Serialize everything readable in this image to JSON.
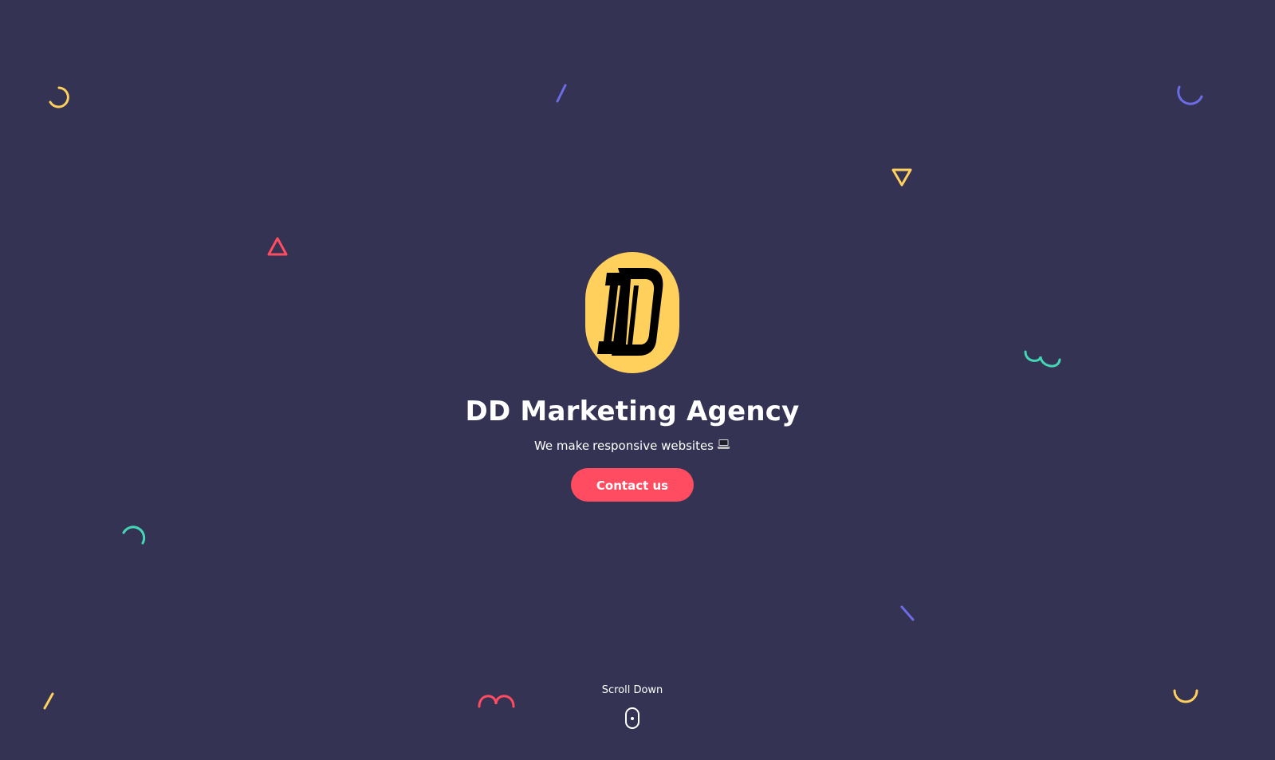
{
  "theme": {
    "background": "#353353",
    "accent_red": "#FF4C60",
    "accent_yellow": "#FFD15C",
    "accent_purple": "#6C6CE5",
    "accent_teal": "#44D7B6"
  },
  "hero": {
    "logo_icon": "dd-monogram-logo",
    "title": "DD Marketing Agency",
    "tagline_prefix": "We make",
    "tagline_rotating": "responsive websites",
    "tagline_icon": "laptop-icon",
    "cta_label": "Contact us"
  },
  "scroll_hint": {
    "label": "Scroll Down",
    "icon": "mouse-icon"
  },
  "decorations": [
    {
      "name": "arc-shape",
      "color": "#FFD15C"
    },
    {
      "name": "line-shape",
      "color": "#6C6CE5"
    },
    {
      "name": "arc-shape",
      "color": "#6C6CE5"
    },
    {
      "name": "triangle-shape",
      "color": "#FFD15C"
    },
    {
      "name": "triangle-shape",
      "color": "#FF4C60"
    },
    {
      "name": "squiggle-shape",
      "color": "#44D7B6"
    },
    {
      "name": "arc-shape",
      "color": "#44D7B6"
    },
    {
      "name": "line-shape",
      "color": "#6C6CE5"
    },
    {
      "name": "line-shape",
      "color": "#FFD15C"
    },
    {
      "name": "squiggle-shape",
      "color": "#FF4C60"
    },
    {
      "name": "arc-shape",
      "color": "#FFD15C"
    }
  ]
}
